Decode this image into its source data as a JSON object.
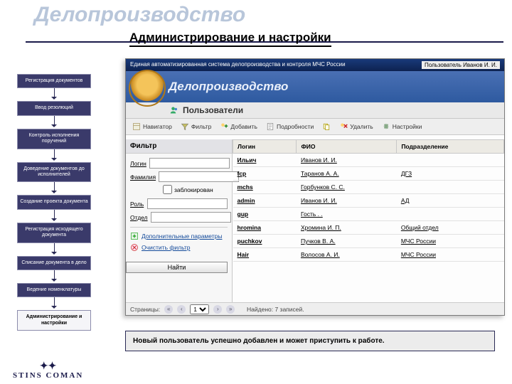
{
  "bg_title": "Делопроизводство",
  "page_title": "Администрирование и настройки",
  "sidebar": {
    "items": [
      {
        "label": "Регистрация документов"
      },
      {
        "label": "Ввод резолюций"
      },
      {
        "label": "Контроль исполнения поручений"
      },
      {
        "label": "Доведение документов до исполнителей"
      },
      {
        "label": "Создание проекта документа"
      },
      {
        "label": "Регистрация исходящего документа"
      },
      {
        "label": "Списание документа в дело"
      },
      {
        "label": "Ведение номенклатуры"
      },
      {
        "label": "Администрирование и настройки",
        "active": true
      }
    ]
  },
  "app": {
    "system_title": "Единая автоматизированная система делопроизводства и контроля МЧС России",
    "user_label": "Пользователь",
    "user_name": "Иванов И. И.",
    "brand": "Делопроизводство",
    "section_title": "Пользователи",
    "toolbar": {
      "navigator": "Навигатор",
      "filter": "Фильтр",
      "add": "Добавить",
      "details": "Подробности",
      "delete": "Удалить",
      "settings": "Настройки"
    },
    "filter": {
      "panel_title": "Фильтр",
      "login": "Логин",
      "surname": "Фамилия",
      "blocked": "заблокирован",
      "role": "Роль",
      "dept": "Отдел",
      "extra": "Дополнительные параметры",
      "clear": "Очистить фильтр",
      "find": "Найти"
    },
    "grid": {
      "columns": [
        "Логин",
        "ФИО",
        "Подразделение"
      ],
      "rows": [
        {
          "login": "Ильич",
          "fio": "Иванов И. И.",
          "dept": ""
        },
        {
          "login": "fcp",
          "fio": "Таранов А. А.",
          "dept": "ДГЗ"
        },
        {
          "login": "mchs",
          "fio": "Горбунков С. С.",
          "dept": ""
        },
        {
          "login": "admin",
          "fio": "Иванов И. И.",
          "dept": "АД"
        },
        {
          "login": "gup",
          "fio": "Гость . .",
          "dept": ""
        },
        {
          "login": "hromina",
          "fio": "Хромина И. П.",
          "dept": "Общий отдел"
        },
        {
          "login": "puchkov",
          "fio": "Пучков В. А.",
          "dept": "МЧС России"
        },
        {
          "login": "Hair",
          "fio": "Волосов А. И.",
          "dept": "МЧС России"
        }
      ]
    },
    "status": {
      "pages_label": "Страницы:",
      "page": "1",
      "found_label": "Найдено: 7 записей."
    }
  },
  "notice": "Новый пользователь успешно добавлен и может приступить к работе.",
  "footer_logo": {
    "top": "✦✦",
    "text": "STINS COMAN"
  }
}
